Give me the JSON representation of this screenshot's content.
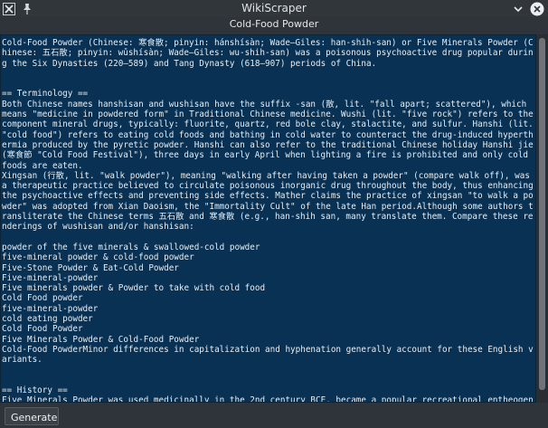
{
  "window": {
    "title": "WikiScraper",
    "subtitle": "Cold-Food Powder"
  },
  "icons": [
    "app-x-icon",
    "pin-icon",
    "chevron-down-icon",
    "close-icon"
  ],
  "colors": {
    "background": "#2f343a",
    "textarea_bg": "#083154",
    "text": "#e9eef2"
  },
  "article": {
    "text": "Cold-Food Powder (Chinese: 寒食散; pinyin: hánshísàn; Wade–Giles: han-shih-san) or Five Minerals Powder (Chinese: 五石散; pinyin: wǔshísàn; Wade–Giles: wu-shih-san) was a poisonous psychoactive drug popular during the Six Dynasties (220–589) and Tang Dynasty (618–907) periods of China.\n\n\n== Terminology ==\nBoth Chinese names hanshisan and wushisan have the suffix -san (散, lit. \"fall apart; scattered\"), which means \"medicine in powdered form\" in Traditional Chinese medicine. Wushi (lit. \"five rock\") refers to the component mineral drugs, typically: fluorite, quartz, red bole clay, stalactite, and sulfur. Hanshi (lit. \"cold food\") refers to eating cold foods and bathing in cold water to counteract the drug-induced hyperthermia produced by the pyretic powder. Hanshi can also refer to the traditional Chinese holiday Hanshi jie (寒食節 \"Cold Food Festival\"), three days in early April when lighting a fire is prohibited and only cold foods are eaten.\nXingsan (行散, lit. \"walk powder\"), meaning \"walking after having taken a powder\" (compare walk off), was a therapeutic practice believed to circulate poisonous inorganic drug throughout the body, thus enhancing the psychoactive effects and preventing side effects. Mather claims the practice of xingsan \"to walk a powder\" was adopted from Xian Daoism, the \"Immortality Cult\" of the late Han period.Although some authors transliterate the Chinese terms 五石散 and 寒食散 (e.g., han-shih san, many translate them. Compare these renderings of wushisan and/or hanshisan:\n\npowder of the five minerals & swallowed-cold powder\nfive-mineral powder & cold-food powder\nFive-Stone Powder & Eat-Cold Powder\nFive-mineral-powder\nFive minerals powder & Powder to take with cold food\nCold Food powder\nfive-mineral-powder\ncold eating powder\nCold Food Powder\nFive Minerals Powder & Cold-Food Powder\nCold-Food PowderMinor differences in capitalization and hyphenation generally account for these English variants.\n\n\n== History ==\nFive Minerals Powder was used medicinally in the 2nd century BCE, became a popular recreational entheogen and s"
  },
  "footer": {
    "generate_label": "Generate"
  }
}
